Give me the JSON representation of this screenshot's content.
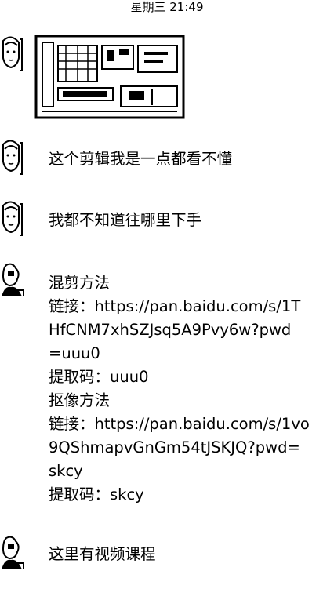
{
  "status": {
    "timestamp": "星期三 21:49"
  },
  "messages": [
    {
      "sender": "contact",
      "type": "image",
      "icon": "screenshot-thumbnail"
    },
    {
      "sender": "contact",
      "type": "text",
      "lines": [
        "这个剪辑我是一点都看不懂"
      ]
    },
    {
      "sender": "contact",
      "type": "text",
      "lines": [
        "我都不知道往哪里下手"
      ]
    },
    {
      "sender": "other",
      "type": "text",
      "lines": [
        "混剪方法",
        "链接：https://pan.baidu.com/s/1T",
        "HfCNM7xhSZJsq5A9Pvy6w?pwd",
        "=uuu0",
        "提取码：uuu0",
        "抠像方法",
        "链接：https://pan.baidu.com/s/1vo",
        "9QShmapvGnGm54tJSKJQ?pwd=",
        "skcy",
        "提取码：skcy"
      ]
    },
    {
      "sender": "other",
      "type": "text",
      "lines": [
        "这里有视频课程"
      ]
    }
  ],
  "colors": {
    "text": "#000000",
    "background": "#ffffff"
  }
}
